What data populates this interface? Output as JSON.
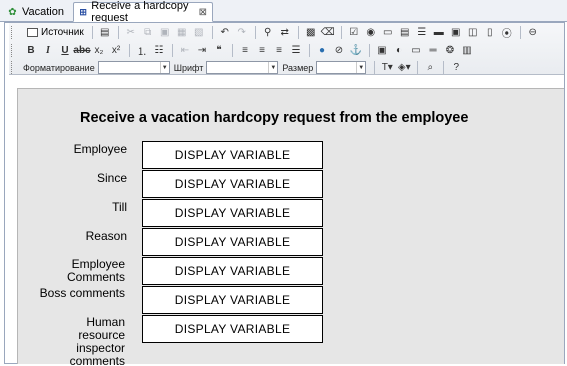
{
  "tabs": [
    {
      "label": "Vacation",
      "icon": "vacation-icon"
    },
    {
      "label": "Receive a hardcopy request",
      "icon": "request-icon",
      "active": true
    }
  ],
  "toolbar": {
    "source_label": "Источник",
    "format_label": "Форматирование",
    "format_value": "",
    "font_label": "Шрифт",
    "font_value": "",
    "size_label": "Размер",
    "size_value": ""
  },
  "form": {
    "title": "Receive a vacation hardcopy request from the employee",
    "fields": [
      {
        "label": "Employee",
        "value": "DISPLAY VARIABLE"
      },
      {
        "label": "Since",
        "value": "DISPLAY VARIABLE"
      },
      {
        "label": "Till",
        "value": "DISPLAY VARIABLE"
      },
      {
        "label": "Reason",
        "value": "DISPLAY VARIABLE"
      },
      {
        "label": "Employee Comments",
        "value": "DISPLAY VARIABLE"
      },
      {
        "label": "Boss comments",
        "value": "DISPLAY VARIABLE"
      },
      {
        "label": "Human resource inspector comments",
        "value": "DISPLAY VARIABLE"
      }
    ]
  }
}
